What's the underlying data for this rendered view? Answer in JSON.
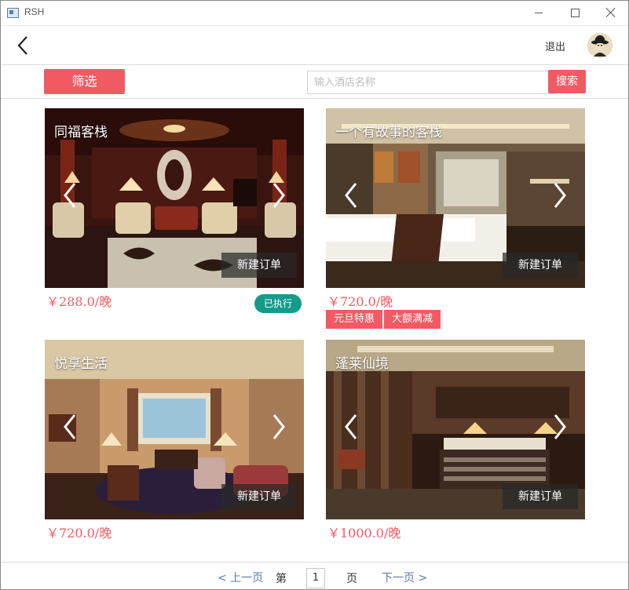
{
  "window": {
    "title": "RSH"
  },
  "header": {
    "logout_label": "退出"
  },
  "toolbar": {
    "filter_label": "筛选",
    "search_placeholder": "输入酒店名称",
    "search_value": "",
    "search_label": "搜索"
  },
  "hotels": [
    {
      "name": "同福客栈",
      "price": "￥288.0/晚",
      "order_label": "新建订单",
      "status": "已执行",
      "tags": []
    },
    {
      "name": "一个有故事的客栈",
      "price": "￥720.0/晚",
      "order_label": "新建订单",
      "status": "",
      "tags": [
        "元旦特惠",
        "大额满减"
      ]
    },
    {
      "name": "悦享生活",
      "price": "￥720.0/晚",
      "order_label": "新建订单",
      "status": "",
      "tags": []
    },
    {
      "name": "蓬莱仙境",
      "price": "￥1000.0/晚",
      "order_label": "新建订单",
      "status": "",
      "tags": []
    }
  ],
  "pagination": {
    "prev_label": "< 上一页",
    "page_prefix": "第",
    "current_page": "1",
    "page_suffix": "页",
    "next_label": "下一页 >"
  },
  "colors": {
    "accent": "#f25a63",
    "status_badge": "#149b8a",
    "link": "#5b7aa6"
  },
  "icons": {
    "back": "chevron-left-icon",
    "carousel_prev": "chevron-left-icon",
    "carousel_next": "chevron-right-icon",
    "avatar": "user-avatar"
  }
}
